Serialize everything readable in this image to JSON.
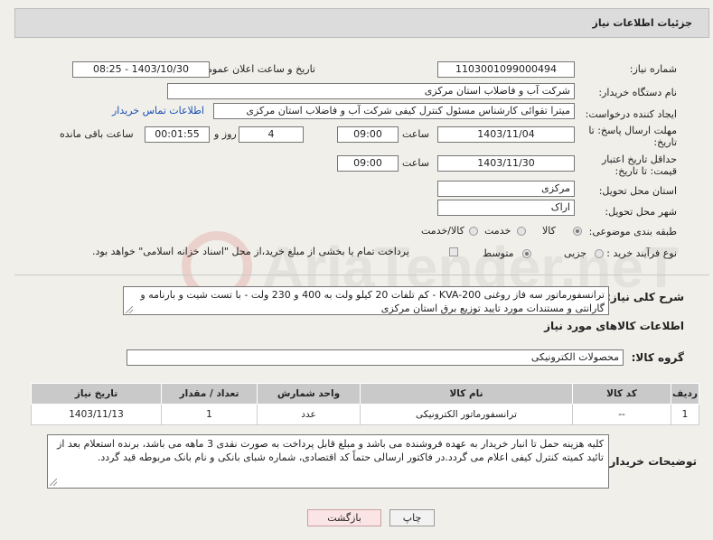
{
  "panel": {
    "title": "جزئیات اطلاعات نیاز"
  },
  "fields": {
    "need_number": {
      "label": "شماره نیاز:",
      "value": "1103001099000494"
    },
    "announce_datetime": {
      "label": "تاریخ و ساعت اعلان عمومی:",
      "value": "1403/10/30 - 08:25"
    },
    "buyer_org": {
      "label": "نام دستگاه خریدار:",
      "value": "شرکت آب و فاضلاب استان مرکزی"
    },
    "requester": {
      "label": "ایجاد کننده درخواست:",
      "value": "میترا تقوائی کارشناس مسئول کنترل کیفی شرکت آب و فاضلاب استان مرکزی",
      "contact_link": "اطلاعات تماس خریدار"
    },
    "reply_deadline": {
      "label": "مهلت ارسال پاسخ: تا تاریخ:",
      "date": "1403/11/04",
      "time_label": "ساعت",
      "time": "09:00",
      "days": "4",
      "days_label": "روز و",
      "remaining": "00:01:55",
      "remaining_label": "ساعت باقی مانده"
    },
    "price_validity": {
      "label": "حداقل تاریخ اعتبار قیمت: تا تاریخ:",
      "date": "1403/11/30",
      "time_label": "ساعت",
      "time": "09:00"
    },
    "province": {
      "label": "استان محل تحویل:",
      "value": "مرکزی"
    },
    "city": {
      "label": "شهر محل تحویل:",
      "value": "اراک"
    },
    "category": {
      "label": "طبقه بندی موضوعی:",
      "options": [
        "کالا",
        "خدمت",
        "کالا/خدمت"
      ],
      "selected": "کالا"
    },
    "purchase_type": {
      "label": "نوع فرآیند خرید :",
      "options": [
        "جزیی",
        "متوسط"
      ],
      "selected": "متوسط",
      "note": "پرداخت تمام یا بخشی از مبلغ خرید،از محل \"اسناد خزانه اسلامی\" خواهد بود."
    }
  },
  "description": {
    "label": "شرح کلی نیاز:",
    "text": "ترانسفورماتور سه فاز روغنی KVA-200 - کم تلفات 20 کیلو ولت به 400 و 230 ولت - با تست شیت و بارنامه و گارانتی و مستندات مورد تایید توزیع برق استان مرکزی"
  },
  "goods_section": {
    "title": "اطلاعات کالاهای مورد نیاز"
  },
  "goods_group": {
    "label": "گروه کالا:",
    "value": "محصولات الکترونیکی"
  },
  "table": {
    "headers": [
      "ردیف",
      "کد کالا",
      "نام کالا",
      "واحد شمارش",
      "تعداد / مقدار",
      "تاریخ نیاز"
    ],
    "rows": [
      [
        "1",
        "--",
        "ترانسفورماتور الکترونیکی",
        "عدد",
        "1",
        "1403/11/13"
      ]
    ]
  },
  "buyer_notes": {
    "label": "توضیحات خریدار:",
    "text": "کلیه هزینه حمل تا انبار خریدار به عهده فروشنده می باشد و مبلغ قابل پرداخت به صورت نقدی 3 ماهه می باشد، برنده استعلام بعد از تائید کمیته کنترل کیفی اعلام می گردد.در فاکتور ارسالی حتماً کد اقتصادی، شماره شبای بانکی و نام بانک مربوطه قید گردد."
  },
  "buttons": {
    "print": "چاپ",
    "back": "بازگشت"
  },
  "watermark": {
    "text": "AriaTender.neT"
  }
}
